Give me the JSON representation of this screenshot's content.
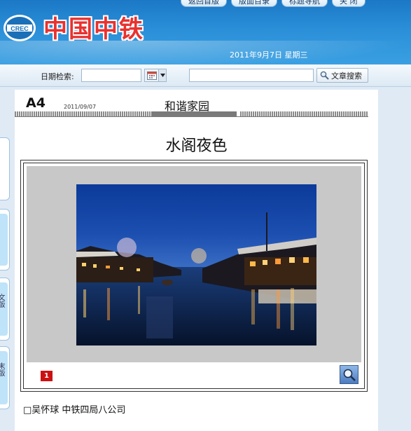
{
  "header": {
    "brand": "中国中铁",
    "logo_text": "CREC",
    "date": "2011年9月7日  星期三",
    "nav": [
      {
        "label": "返回首版"
      },
      {
        "label": "版面目录"
      },
      {
        "label": "标题导航"
      },
      {
        "label": "关 闭"
      }
    ]
  },
  "search": {
    "date_label": "日期检索:",
    "date_value": "",
    "keyword_value": "",
    "search_button": "文章搜索"
  },
  "side_tabs": [
    {
      "text": ""
    },
    {
      "text": ""
    },
    {
      "text": "文版"
    },
    {
      "text": "末版"
    }
  ],
  "page": {
    "code": "A4",
    "date": "2011/09/07",
    "section": "和谐家园"
  },
  "article": {
    "title": "水阁夜色",
    "photo_index": "1",
    "byline": "□吴怀球  中铁四局八公司"
  },
  "colors": {
    "header_blue": "#2a8fd8",
    "brand_red": "#e8322f",
    "badge_red": "#cc1111"
  },
  "icons": {
    "calendar": "calendar-icon",
    "search": "magnifier-icon",
    "zoom": "zoom-icon"
  }
}
